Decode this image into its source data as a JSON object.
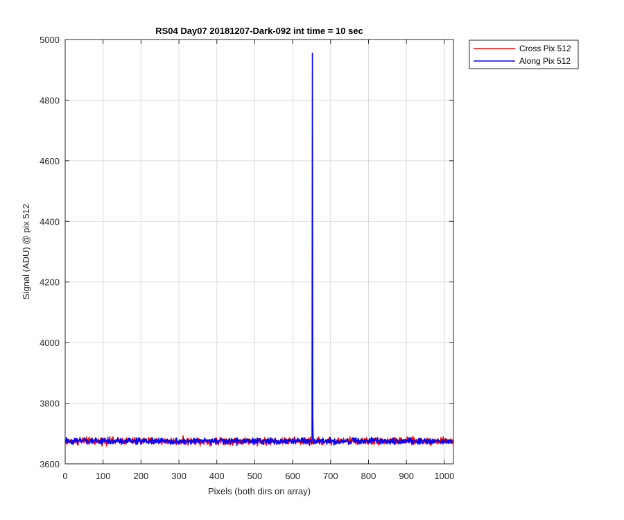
{
  "chart_data": {
    "type": "line",
    "title": "RS04 Day07 20181207-Dark-092 int time = 10 sec",
    "xlabel": "Pixels (both dirs on array)",
    "ylabel": "Signal (ADU) @ pix 512",
    "xlim": [
      0,
      1024
    ],
    "ylim": [
      3600,
      5000
    ],
    "xticks": [
      0,
      100,
      200,
      300,
      400,
      500,
      600,
      700,
      800,
      900,
      1000
    ],
    "yticks": [
      3600,
      3800,
      4000,
      4200,
      4400,
      4600,
      4800,
      5000
    ],
    "grid": true,
    "legend_position": "outside top-right",
    "series": [
      {
        "name": "Cross Pix 512",
        "color": "#ff0000",
        "baseline": 3675,
        "noise_amplitude": 10,
        "spikes": []
      },
      {
        "name": "Along Pix 512",
        "color": "#0000ff",
        "baseline": 3675,
        "noise_amplitude": 9,
        "spikes": [
          {
            "x": 652,
            "y": 4955
          }
        ]
      }
    ]
  }
}
